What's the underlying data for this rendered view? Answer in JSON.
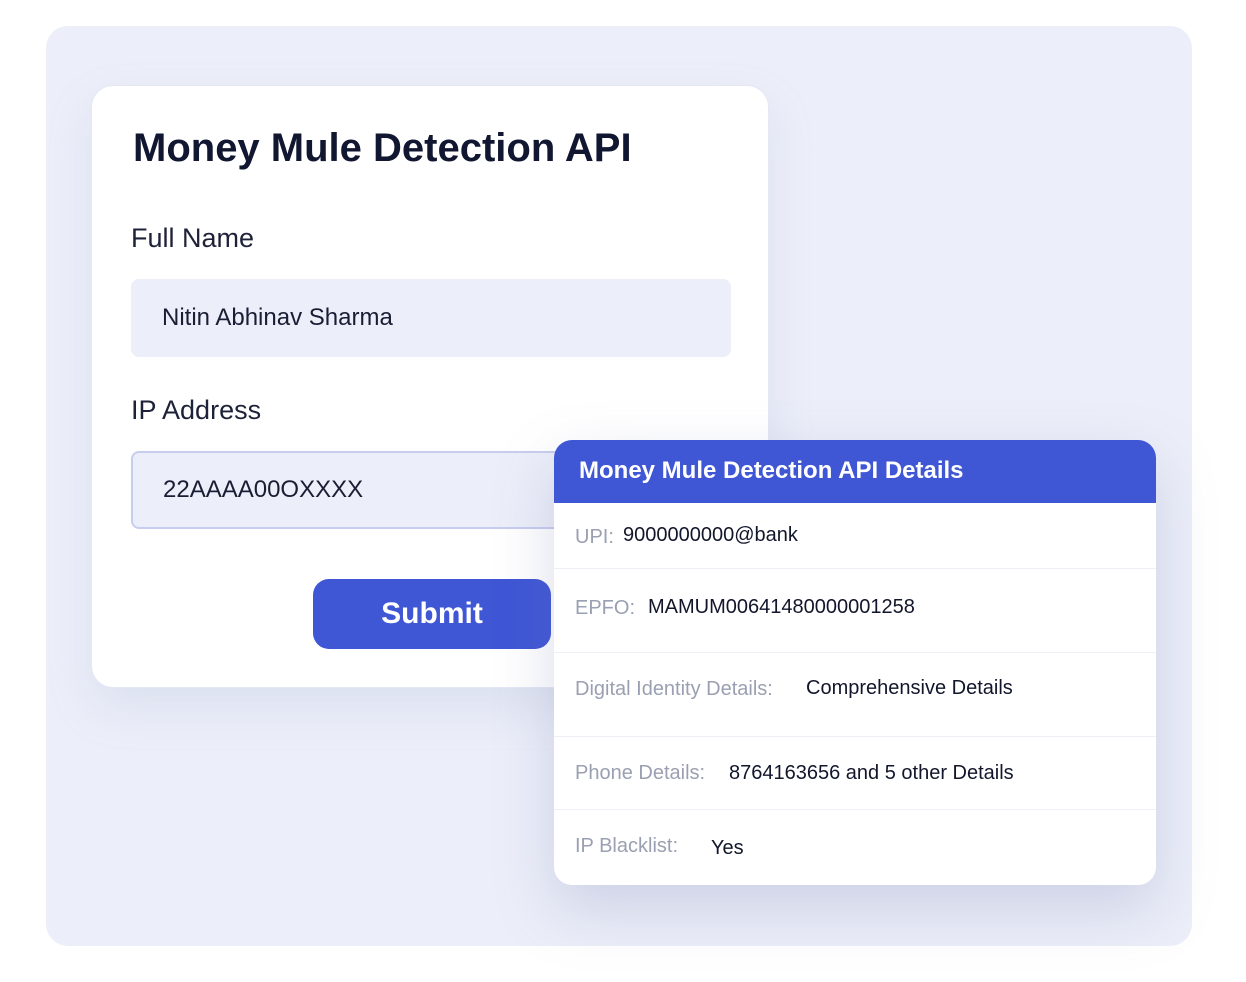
{
  "form": {
    "title": "Money Mule Detection API",
    "full_name_label": "Full Name",
    "full_name_value": "Nitin Abhinav Sharma",
    "ip_label": "IP Address",
    "ip_value": "22AAAA00OXXXX",
    "submit_label": "Submit"
  },
  "details": {
    "title": "Money Mule Detection API Details",
    "rows": [
      {
        "key": "UPI:",
        "value": "9000000000@bank"
      },
      {
        "key": "EPFO:",
        "value": "MAMUM00641480000001258"
      },
      {
        "key": "Digital Identity Details:",
        "value": "Comprehensive Details"
      },
      {
        "key": "Phone Details:",
        "value": "8764163656 and 5 other Details"
      },
      {
        "key": "IP Blacklist:",
        "value": "Yes"
      }
    ]
  },
  "colors": {
    "accent": "#3f56d5",
    "background": "#eceff9",
    "input_background": "#eceef9"
  }
}
